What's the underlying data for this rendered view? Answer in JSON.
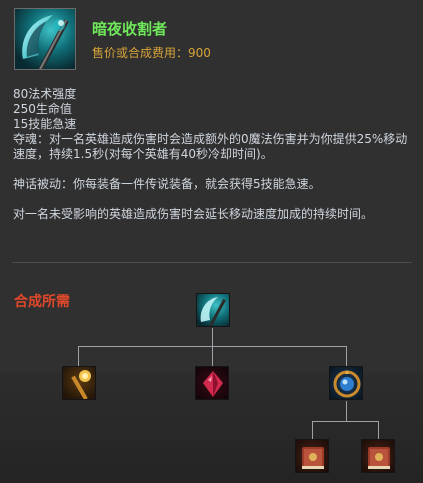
{
  "item": {
    "name": "暗夜收割者",
    "price_label": "售价或合成费用：900",
    "icon": "night-harvester-scythe-icon"
  },
  "stats": [
    "80法术强度",
    "250生命值",
    "15技能急速"
  ],
  "passives": {
    "soul_rend": "夺魂：对一名英雄造成伤害时会造成额外的0魔法伤害并为你提供25%移动速度，持续1.5秒(对每个英雄有40秒冷却时间)。",
    "mythic": "神话被动：你每装备一件传说装备，就会获得5技能急速。",
    "note": "对一名未受影响的英雄造成伤害时会延长移动速度加成的持续时间。"
  },
  "recipe": {
    "title": "合成所需",
    "root_icon": "night-harvester-scythe-icon",
    "components": [
      {
        "icon": "golden-staff-icon"
      },
      {
        "icon": "ruby-crystal-icon"
      },
      {
        "icon": "blue-gem-compass-icon",
        "components": [
          {
            "icon": "amplifying-tome-icon"
          },
          {
            "icon": "amplifying-tome-icon"
          }
        ]
      }
    ]
  },
  "colors": {
    "background": "#303030",
    "title": "#6ee85a",
    "price": "#d8a339",
    "recipe_title": "#e0482a",
    "text": "#cfd6de",
    "tree_line": "#9ea2a6"
  }
}
